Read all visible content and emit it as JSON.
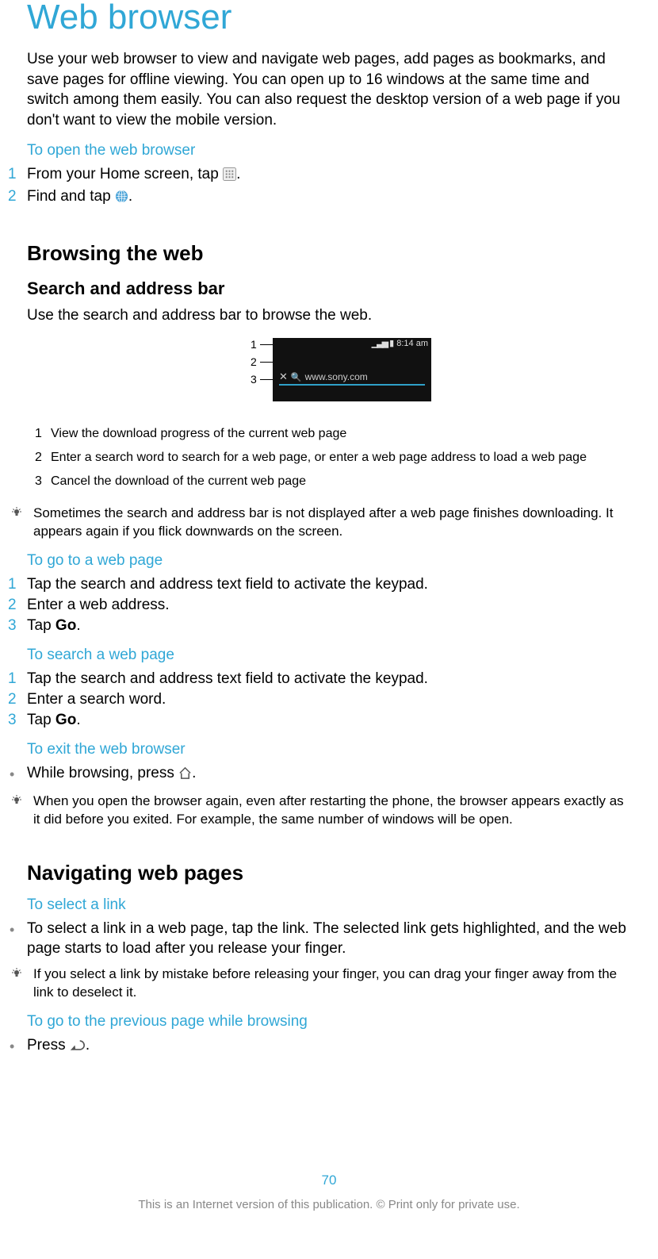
{
  "title": "Web browser",
  "intro": "Use your web browser to view and navigate web pages, add pages as bookmarks, and save pages for offline viewing. You can open up to 16 windows at the same time and switch among them easily. You can also request the desktop version of a web page if you don't want to view the mobile version.",
  "open_browser": {
    "heading": "To open the web browser",
    "steps": [
      "From your Home screen, tap ",
      "Find and tap "
    ]
  },
  "browsing": {
    "heading": "Browsing the web",
    "search_bar": {
      "heading": "Search and address bar",
      "desc": "Use the search and address bar to browse the web.",
      "address_text": "www.sony.com",
      "status_time": "8:14 am",
      "ref": [
        {
          "n": "1",
          "text": "View the download progress of the current web page"
        },
        {
          "n": "2",
          "text": "Enter a search word to search for a web page, or enter a web page address to load a web page"
        },
        {
          "n": "3",
          "text": "Cancel the download of the current web page"
        }
      ],
      "tip": "Sometimes the search and address bar is not displayed after a web page finishes downloading. It appears again if you flick downwards on the screen."
    },
    "go_to_page": {
      "heading": "To go to a web page",
      "steps": [
        "Tap the search and address text field to activate the keypad.",
        "Enter a web address.",
        {
          "pre": "Tap ",
          "bold": "Go",
          "post": "."
        }
      ]
    },
    "search_page": {
      "heading": "To search a web page",
      "steps": [
        "Tap the search and address text field to activate the keypad.",
        "Enter a search word.",
        {
          "pre": "Tap ",
          "bold": "Go",
          "post": "."
        }
      ]
    },
    "exit": {
      "heading": "To exit the web browser",
      "bullet": "While browsing, press ",
      "tip": "When you open the browser again, even after restarting the phone, the browser appears exactly as it did before you exited. For example, the same number of windows will be open."
    }
  },
  "navigating": {
    "heading": "Navigating web pages",
    "select_link": {
      "heading": "To select a link",
      "bullet": "To select a link in a web page, tap the link. The selected link gets highlighted, and the web page starts to load after you release your finger.",
      "tip": "If you select a link by mistake before releasing your finger, you can drag your finger away from the link to deselect it."
    },
    "prev_page": {
      "heading": "To go to the previous page while browsing",
      "bullet": "Press "
    }
  },
  "footer": {
    "page": "70",
    "legal": "This is an Internet version of this publication. © Print only for private use."
  }
}
